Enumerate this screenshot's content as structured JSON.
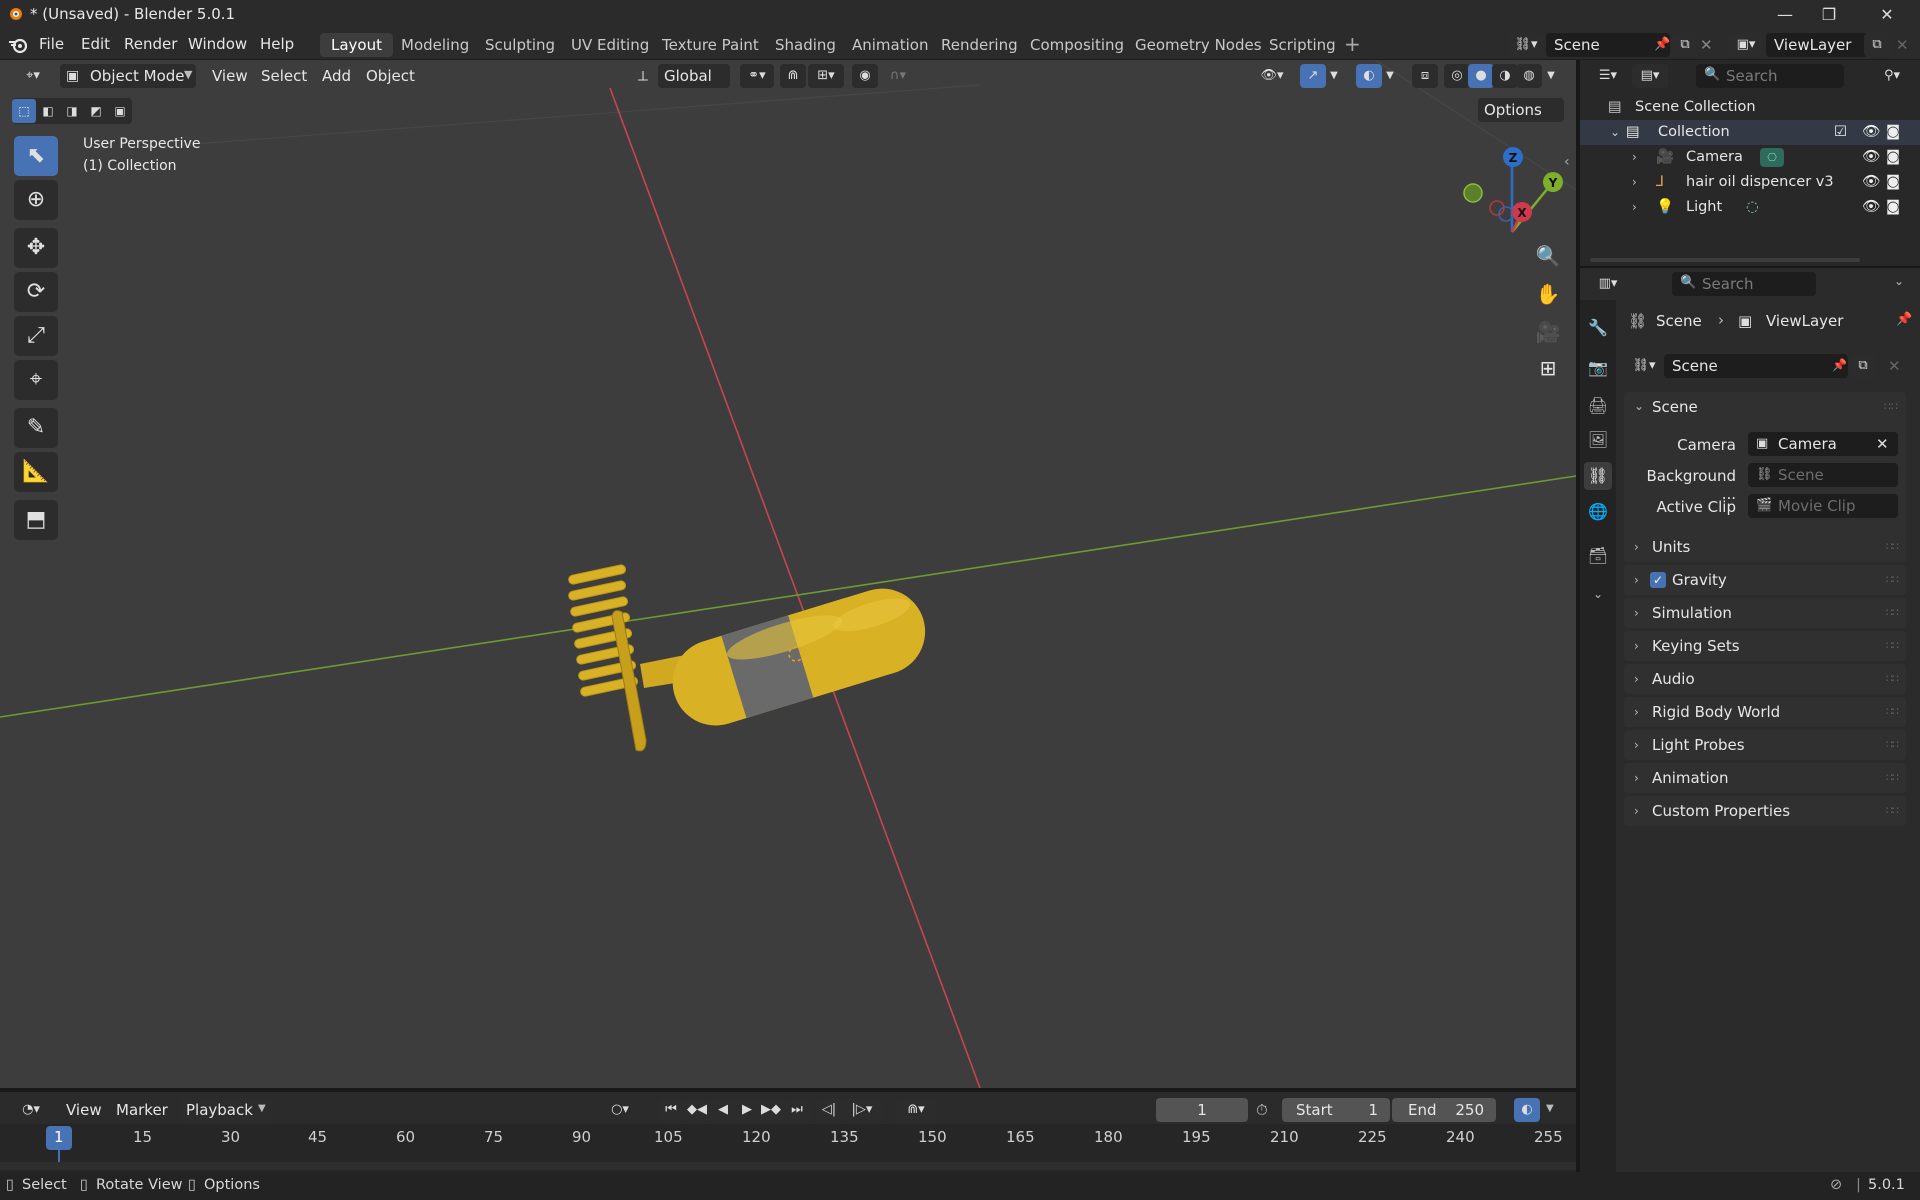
{
  "window": {
    "title": "* (Unsaved) - Blender 5.0.1",
    "controls": {
      "minimize": "—",
      "maximize": "❐",
      "close": "✕"
    }
  },
  "menubar": {
    "items": [
      "File",
      "Edit",
      "Render",
      "Window",
      "Help"
    ],
    "workspaces": [
      "Layout",
      "Modeling",
      "Sculpting",
      "UV Editing",
      "Texture Paint",
      "Shading",
      "Animation",
      "Rendering",
      "Compositing",
      "Geometry Nodes",
      "Scripting"
    ],
    "active_workspace": "Layout",
    "add_workspace": "+",
    "scene": "Scene",
    "view_layer": "ViewLayer"
  },
  "viewport": {
    "mode": "Object Mode",
    "menus": [
      "View",
      "Select",
      "Add",
      "Object"
    ],
    "orientation": "Global",
    "options": "Options",
    "overlay_line1": "User Perspective",
    "overlay_line2": "(1) Collection",
    "gizmo": {
      "z": "Z",
      "y": "Y",
      "x": "X"
    },
    "colors": {
      "background": "#3d3d3d",
      "x_axis": "#c7454f",
      "y_axis": "#6f9a2f",
      "object": "#d8b124",
      "band": "#6a6a6a"
    }
  },
  "outliner": {
    "search_placeholder": "Search",
    "root": "Scene Collection",
    "collection": "Collection",
    "items": [
      {
        "name": "Camera",
        "icon": "camera-icon"
      },
      {
        "name": "hair oil dispencer v3",
        "icon": "armature-icon"
      },
      {
        "name": "Light",
        "icon": "light-icon"
      }
    ]
  },
  "properties": {
    "search_placeholder": "Search",
    "breadcrumb": {
      "scene": "Scene",
      "view_layer": "ViewLayer"
    },
    "scene_name": "Scene",
    "scene_panel": "Scene",
    "fields": [
      {
        "label": "Camera",
        "value": "Camera",
        "empty": false
      },
      {
        "label": "Background ...",
        "value": "Scene",
        "empty": true
      },
      {
        "label": "Active Clip",
        "value": "Movie Clip",
        "empty": true
      }
    ],
    "panels": [
      "Units",
      "Gravity",
      "Simulation",
      "Keying Sets",
      "Audio",
      "Rigid Body World",
      "Light Probes",
      "Animation",
      "Custom Properties"
    ]
  },
  "timeline": {
    "menus": [
      "View",
      "Marker"
    ],
    "playback": "Playback",
    "current_frame": "1",
    "start_label": "Start",
    "start": "1",
    "end_label": "End",
    "end": "250",
    "ticks": [
      "1",
      "15",
      "30",
      "45",
      "60",
      "75",
      "90",
      "105",
      "120",
      "135",
      "150",
      "165",
      "180",
      "195",
      "210",
      "225",
      "240",
      "255"
    ]
  },
  "statusbar": {
    "select": "Select",
    "rotate": "Rotate View",
    "options": "Options",
    "version": "5.0.1"
  }
}
